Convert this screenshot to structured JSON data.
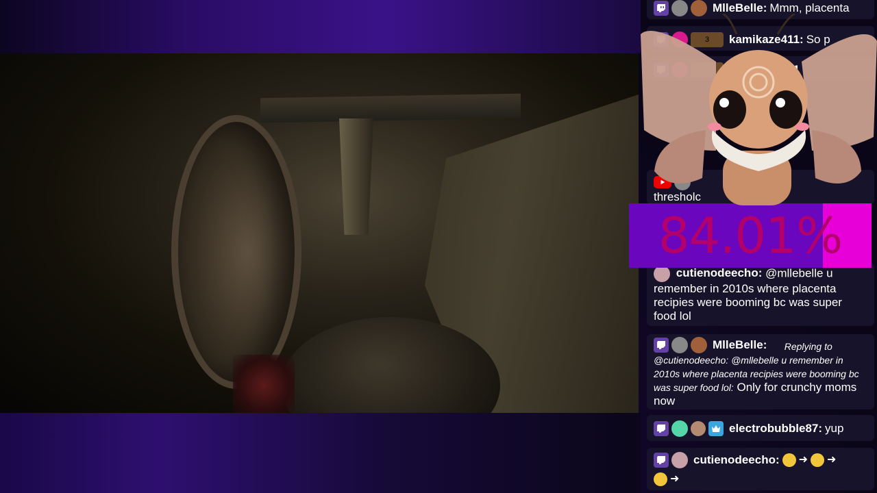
{
  "meter": {
    "value_text": "84.01%",
    "fill_fraction": 0.2
  },
  "chat": [
    {
      "user": "MlleBelle:",
      "text": "Mmm, placenta"
    },
    {
      "user": "kamikaze411:",
      "text": "So p",
      "gift_count": "3"
    },
    {
      "user": "kamikaze411",
      "text": ""
    },
    {
      "user": "",
      "text": "thresholc"
    },
    {
      "user": "cutienodeecho:",
      "text": "@mllebelle u remember in 2010s where placenta recipies were booming bc was super food lol"
    },
    {
      "user": "MlleBelle:",
      "reply_label": "Replying to @cutienodeecho: @mllebelle u remember in 2010s where placenta recipies were booming bc was super food lol:",
      "text": "Only for crunchy moms now"
    },
    {
      "user": "electrobubble87:",
      "text": "yup"
    },
    {
      "user": "cutienodeecho:",
      "text": ""
    }
  ],
  "colors": {
    "chat_bg": "#17132a",
    "meter_base": "#6a06bd",
    "meter_fill": "#e800d9",
    "twitch": "#6441a5",
    "youtube": "#e00000"
  },
  "icons": [
    "twitch-icon",
    "youtube-icon",
    "avatar",
    "crown-icon",
    "egg-icon",
    "gift-icon",
    "emoji-icon",
    "arrow-icon"
  ]
}
